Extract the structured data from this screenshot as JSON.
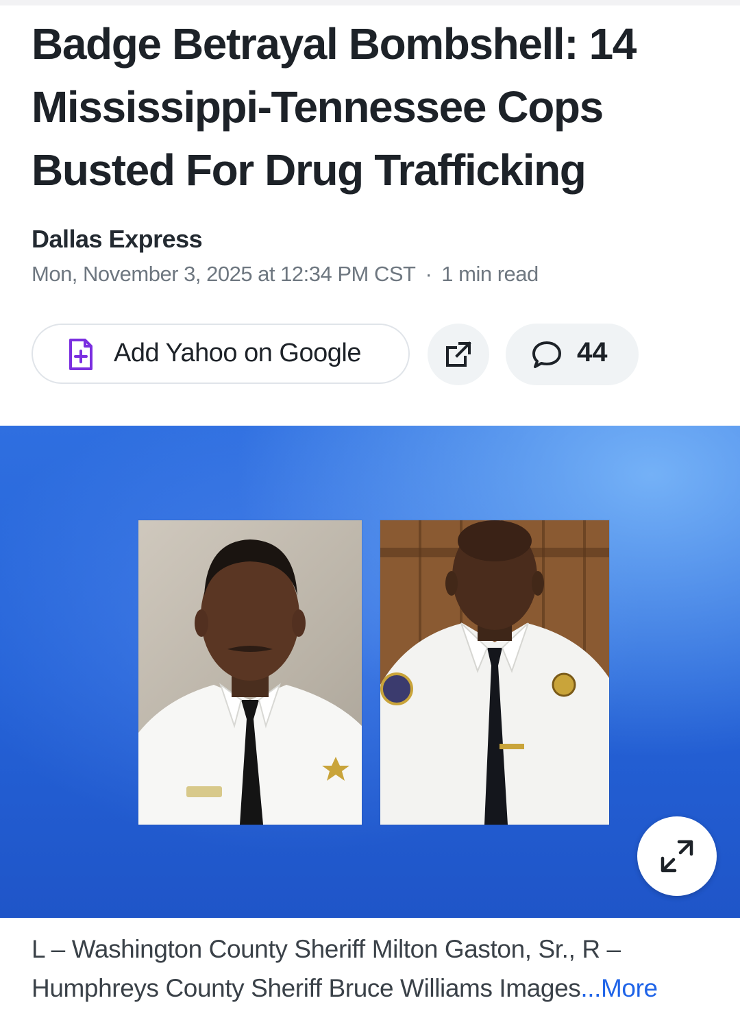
{
  "article": {
    "headline": "Badge Betrayal Bombshell: 14 Mississippi-Tennessee Cops Busted For Drug Trafficking",
    "source": "Dallas Express",
    "date": "Mon, November 3, 2025 at 12:34 PM CST",
    "separator": "·",
    "read_time": "1 min read"
  },
  "actions": {
    "add_google_label": "Add Yahoo on Google",
    "add_google_icon": "doc-plus-icon",
    "share_icon": "share-external-icon",
    "comments_icon": "speech-bubble-icon",
    "comments_count": "44",
    "accent_color": "#7b2fe0"
  },
  "hero": {
    "background_color": "#2563d8",
    "expand_icon": "expand-arrows-icon"
  },
  "caption": {
    "text": "L – Washington County Sheriff Milton Gaston, Sr., R – Humphreys County Sheriff Bruce Williams Images",
    "more_label": "...More",
    "more_color": "#1f64e8"
  }
}
